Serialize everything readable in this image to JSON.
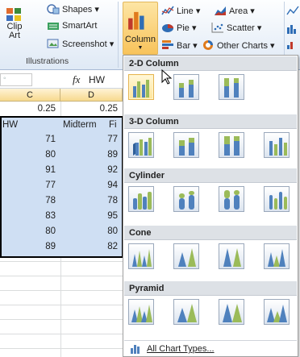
{
  "ribbon": {
    "clip_art": "Clip Art",
    "clip_art_l1": "Clip",
    "clip_art_l2": "Art",
    "shapes": "Shapes ▾",
    "smartart": "SmartArt",
    "screenshot": "Screenshot ▾",
    "illustrations": "Illustrations",
    "column": "Column",
    "line": "Line ▾",
    "area": "Area ▾",
    "pie": "Pie ▾",
    "scatter": "Scatter ▾",
    "bar": "Bar ▾",
    "other_charts": "Other Charts ▾"
  },
  "formula_bar": {
    "fx": "fx",
    "value": "HW"
  },
  "columns": [
    "C",
    "D"
  ],
  "rows": [
    {
      "c": "0.25",
      "d": "0.25"
    },
    {
      "c": "HW",
      "d": "Midterm",
      "e": "Fi"
    },
    {
      "c": "71",
      "d": "77"
    },
    {
      "c": "80",
      "d": "89"
    },
    {
      "c": "91",
      "d": "92"
    },
    {
      "c": "77",
      "d": "94"
    },
    {
      "c": "78",
      "d": "78"
    },
    {
      "c": "83",
      "d": "95"
    },
    {
      "c": "80",
      "d": "80"
    },
    {
      "c": "89",
      "d": "82"
    }
  ],
  "dropdown": {
    "sections": [
      "2-D Column",
      "3-D Column",
      "Cylinder",
      "Cone",
      "Pyramid"
    ],
    "all_chart_types": "All Chart Types..."
  },
  "colors": {
    "accent": "#f8c35b",
    "selection": "#cfdff3",
    "bar_blue": "#4f81bd"
  }
}
